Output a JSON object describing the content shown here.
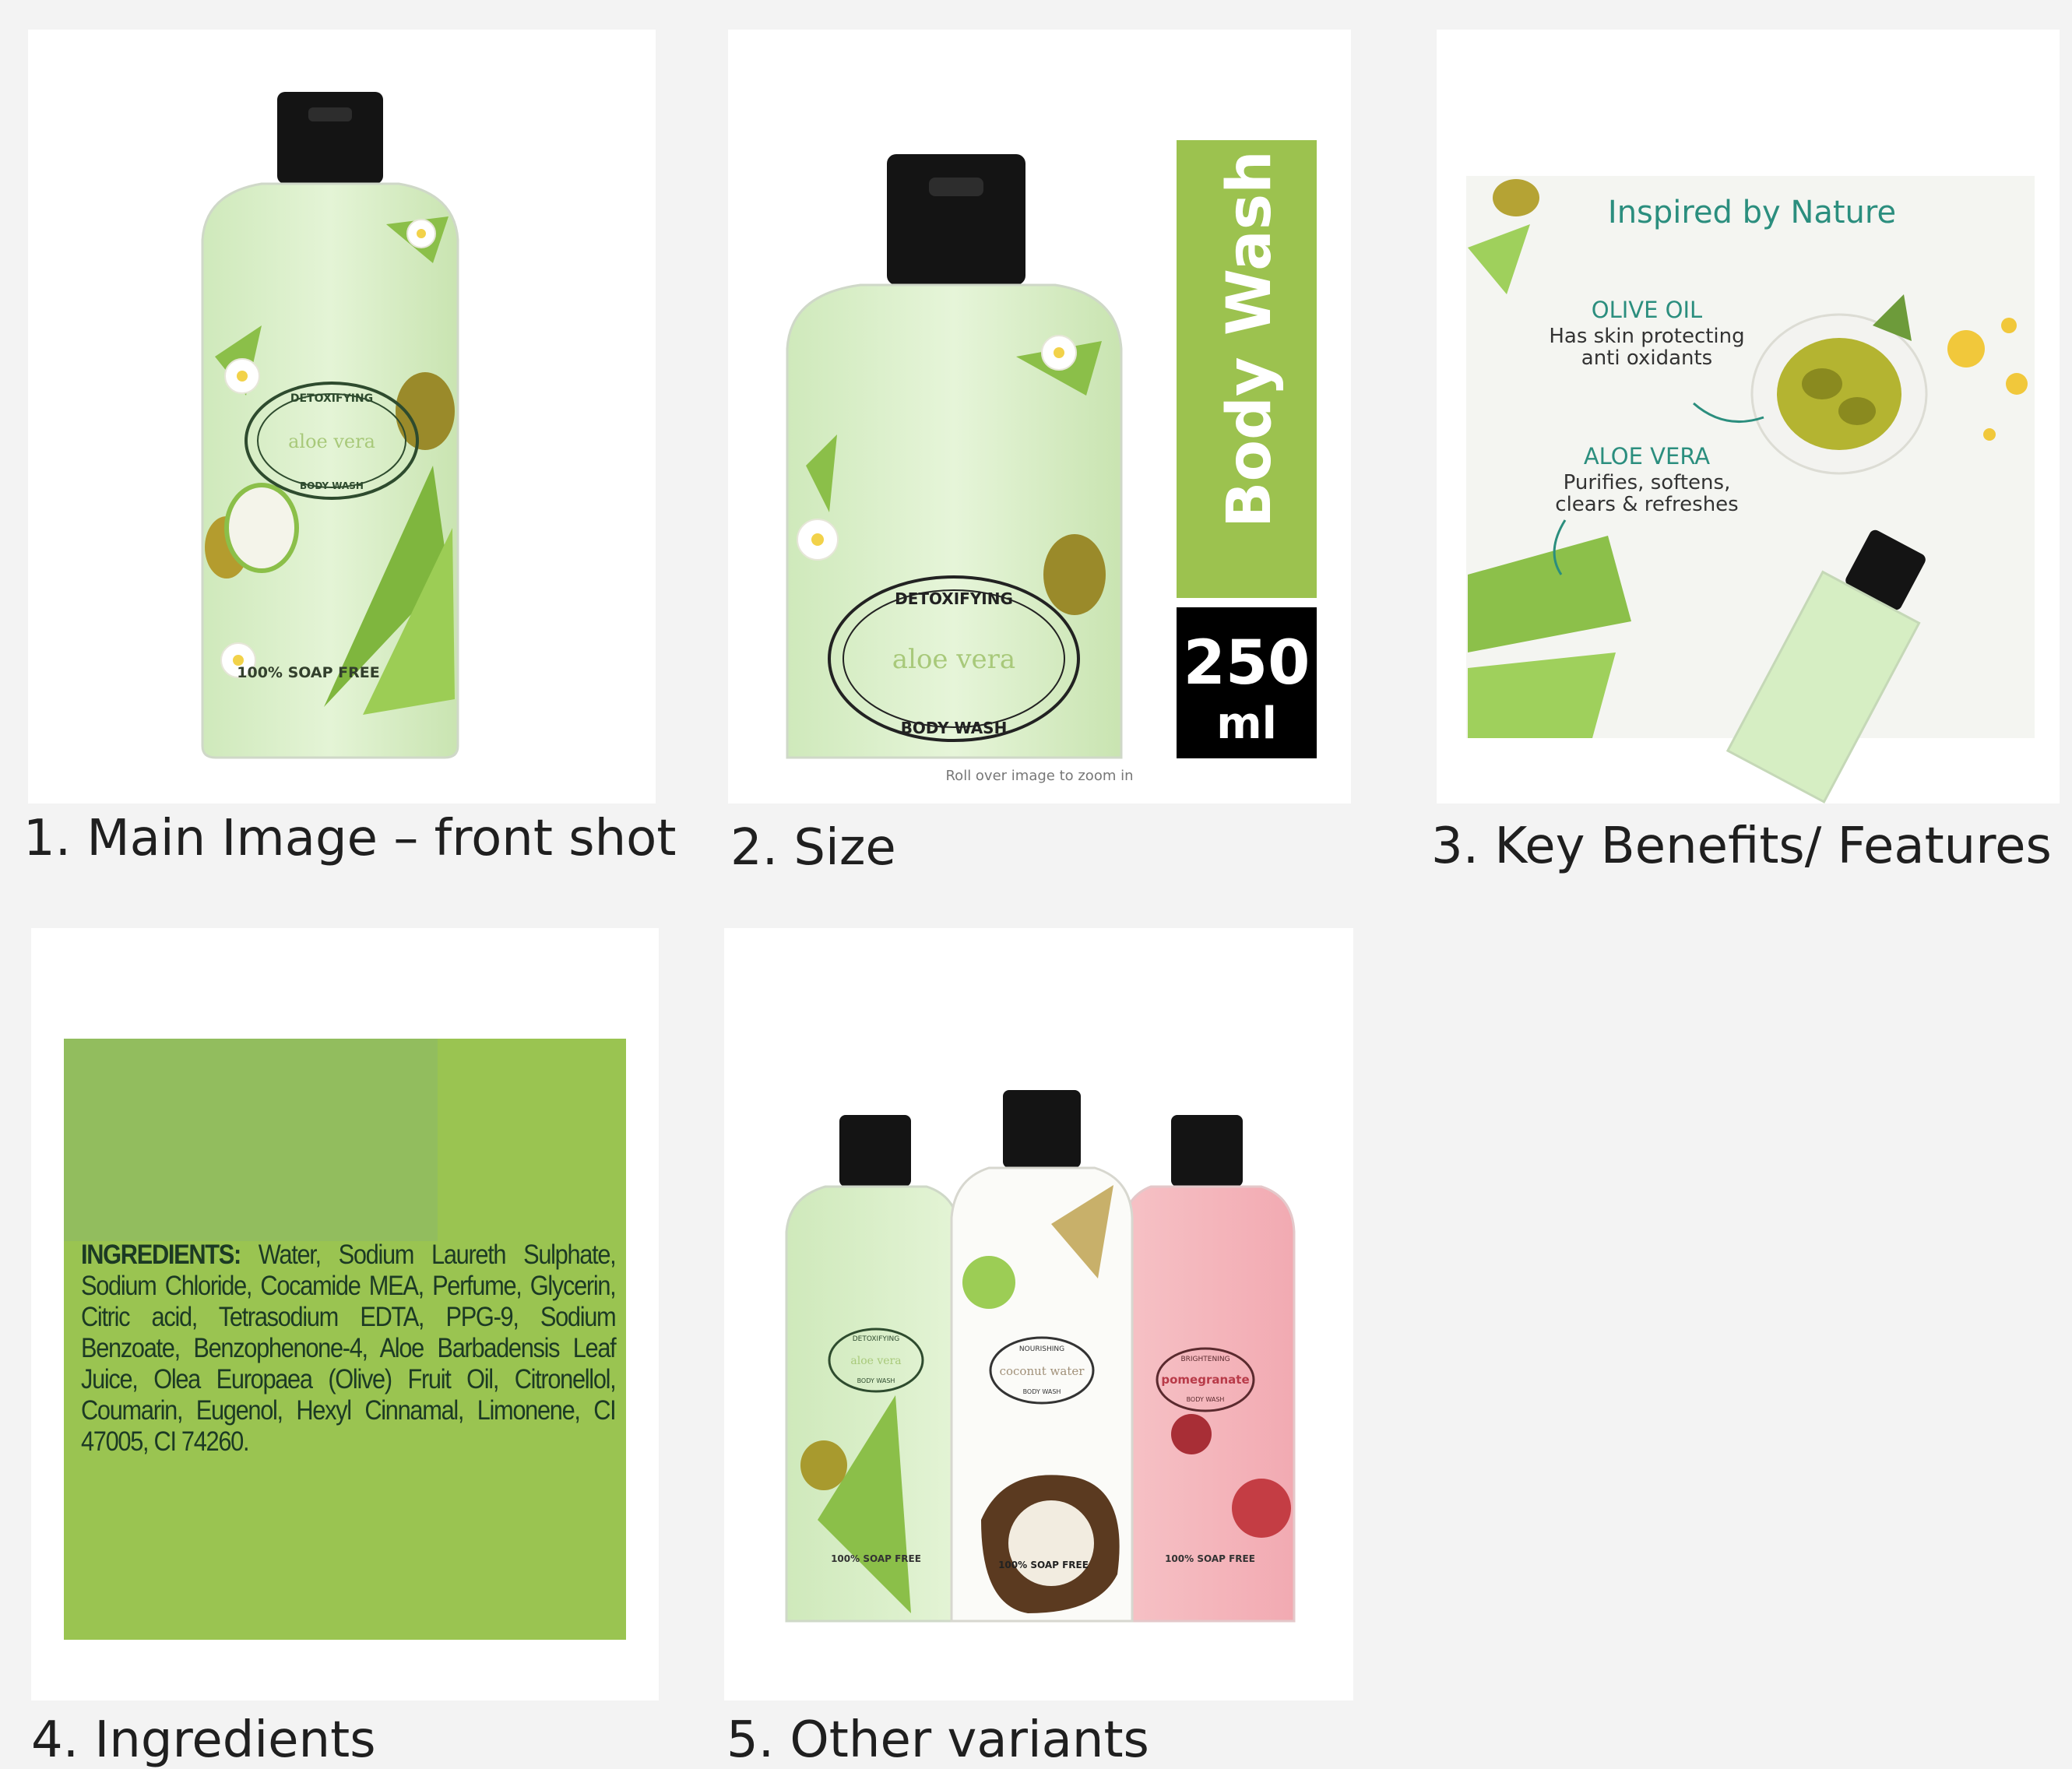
{
  "panels": [
    {
      "caption": "1. Main Image – front shot"
    },
    {
      "caption": "2. Size"
    },
    {
      "caption": "3. Key Benefits/ Features"
    },
    {
      "caption": "4. Ingredients"
    },
    {
      "caption": "5. Other variants"
    }
  ],
  "bottle_label": {
    "top": "DETOXIFYING",
    "name": "aloe vera",
    "bottom": "BODY WASH",
    "soap_free": "100% SOAP FREE"
  },
  "size_panel": {
    "product_type": "Body Wash",
    "volume_number": "250",
    "volume_unit": "ml",
    "zoom_hint": "Roll over image to zoom in",
    "label_top": "DETOXIFYING",
    "label_name": "aloe vera",
    "label_bottom": "BODY WASH"
  },
  "benefits_panel": {
    "heading": "Inspired by Nature",
    "olive_title": "OLIVE OIL",
    "olive_desc_1": "Has skin protecting",
    "olive_desc_2": "anti oxidants",
    "aloe_title": "ALOE VERA",
    "aloe_desc_1": "Purifies, softens,",
    "aloe_desc_2": "clears & refreshes"
  },
  "ingredients_panel": {
    "label": "INGREDIENTS:",
    "text": "Water, Sodium Laureth Sulphate, Sodium Chloride, Cocamide MEA, Perfume, Glycerin, Citric acid, Tetrasodium EDTA, PPG-9, Sodium Benzoate, Benzophenone-4, Aloe Barbadensis Leaf Juice, Olea Europaea (Olive) Fruit Oil, Citronellol, Coumarin, Eugenol, Hexyl Cinnamal, Limonene, CI 47005, CI 74260."
  },
  "variants_panel": {
    "left_top": "DETOXIFYING",
    "left_name": "aloe vera",
    "left_bottom": "BODY WASH",
    "mid_top": "NOURISHING",
    "mid_name": "coconut water",
    "mid_bottom": "BODY WASH",
    "right_top": "BRIGHTENING",
    "right_name": "pomegranate",
    "right_bottom": "BODY WASH",
    "soap_free": "100% SOAP FREE"
  },
  "colors": {
    "background": "#f3f3f3",
    "accent_green": "#9cc24f",
    "ingredients_bg": "#9ac451",
    "teal_text": "#2b8e7e",
    "pink_bottle": "#f4b7bd"
  }
}
